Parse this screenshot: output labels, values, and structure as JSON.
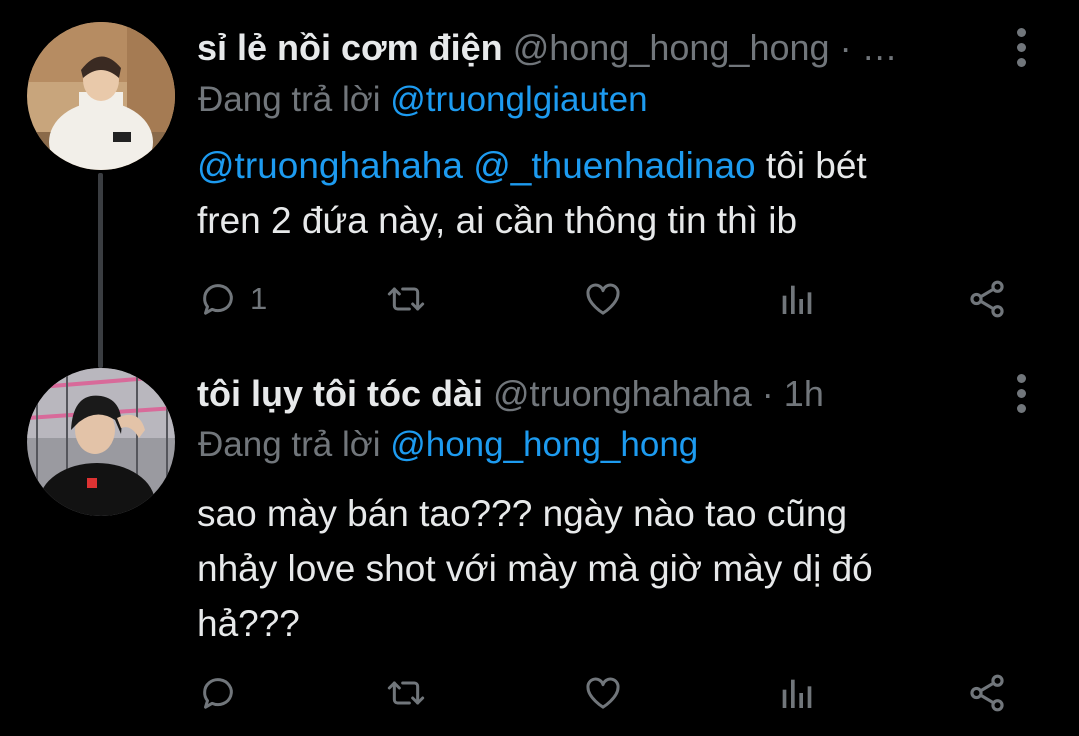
{
  "tweets": [
    {
      "display_name": "sỉ lẻ nồi cơm điện",
      "handle": "@hong_hong_hong",
      "dot": "·",
      "time": "…",
      "reply_prefix": "Đang trả lời",
      "reply_to": "@truonglgiauten",
      "body": {
        "mention1": "@truonghahaha",
        "mention2": "@_thuenhadinao",
        "text1": "tôi bét",
        "text2": "fren 2 đứa này, ai cần thông tin thì ib"
      },
      "actions": {
        "reply_icon": "reply-icon",
        "reply_count": "1",
        "retweet_icon": "retweet-icon",
        "like_icon": "heart-icon",
        "stats_icon": "analytics-icon",
        "share_icon": "share-icon"
      }
    },
    {
      "display_name": "tôi lụy tôi tóc dài",
      "handle": "@truonghahaha",
      "dot": "·",
      "time": "1h",
      "reply_prefix": "Đang trả lời",
      "reply_to": "@hong_hong_hong",
      "body": {
        "line1": "sao mày bán tao??? ngày nào tao cũng",
        "line2": "nhảy love shot với mày mà giờ mày dị đó",
        "line3": "hả???"
      },
      "actions": {
        "reply_icon": "reply-icon",
        "retweet_icon": "retweet-icon",
        "like_icon": "heart-icon",
        "stats_icon": "analytics-icon",
        "share_icon": "share-icon"
      }
    }
  ],
  "colors": {
    "background": "#000000",
    "text": "#e7e9ea",
    "secondary": "#71767b",
    "accent": "#1d9bf0",
    "thread_line": "#3a3d41"
  }
}
